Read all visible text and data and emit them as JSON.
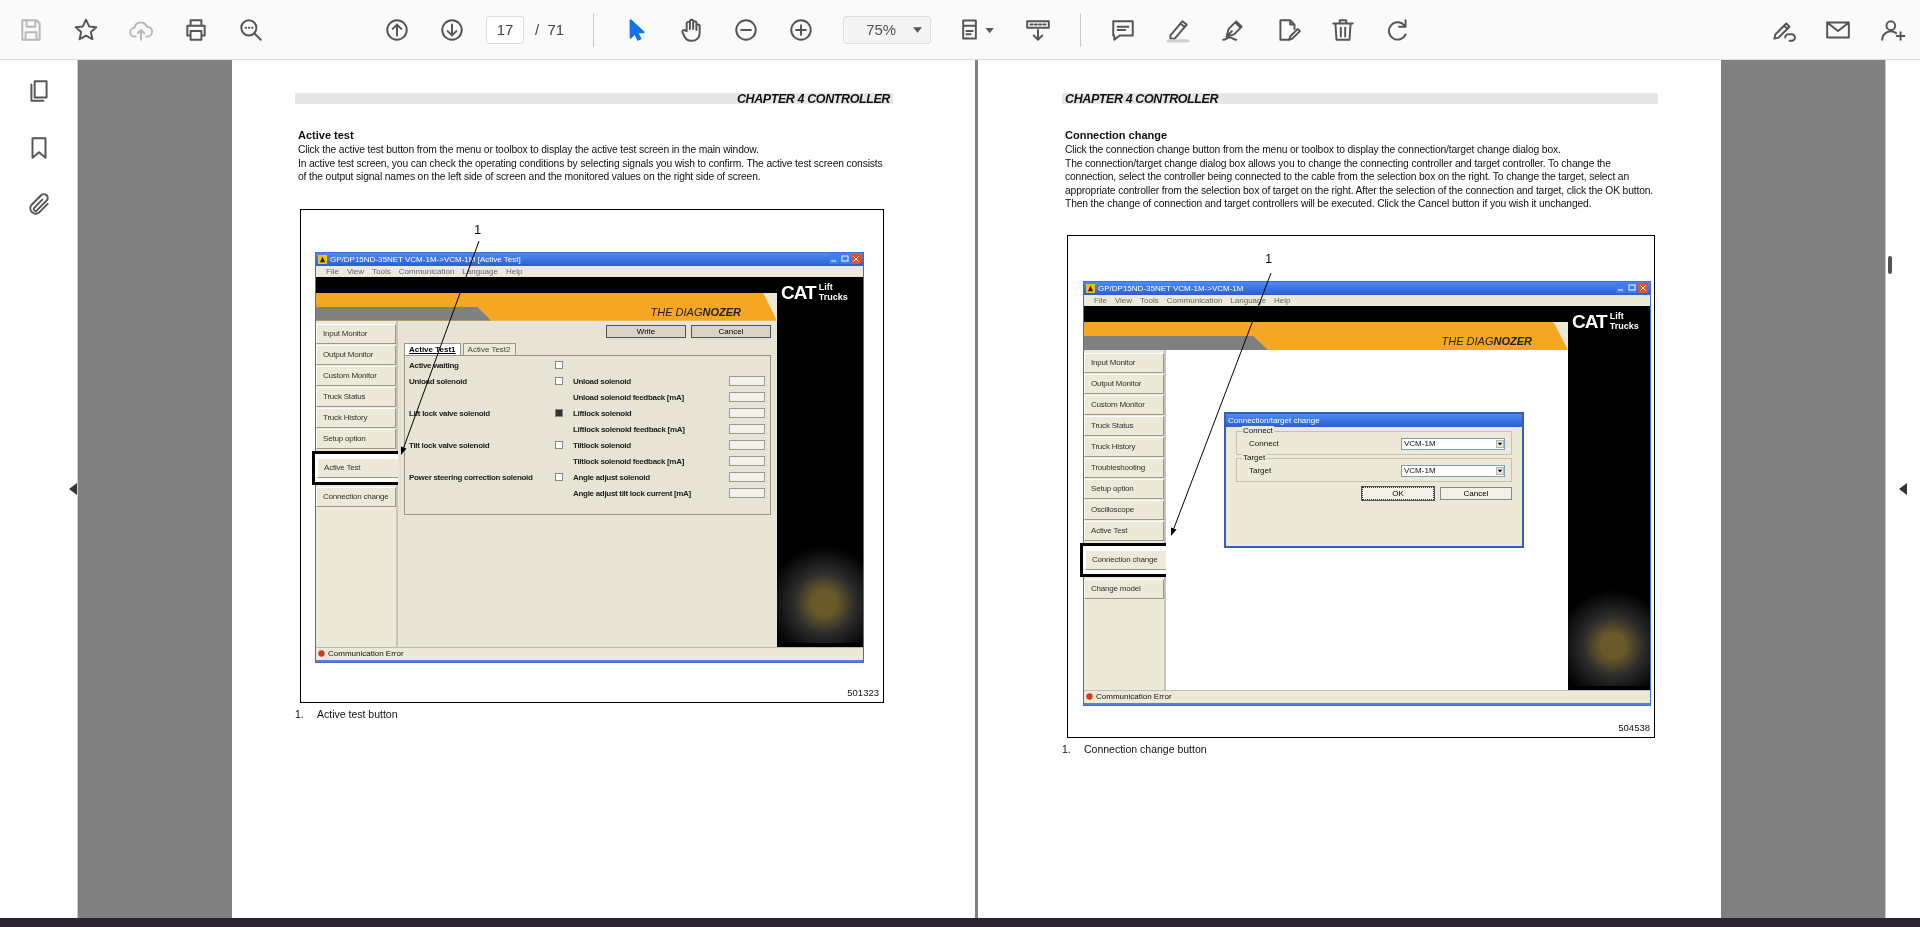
{
  "toolbar": {
    "page_current": "17",
    "page_separator": "/",
    "page_total": "71",
    "zoom": "75%"
  },
  "pages": [
    {
      "header": "CHAPTER 4 CONTROLLER",
      "heading": "Active test",
      "paragraphs": [
        "Click the active test button from the menu or toolbox to display the active test screen in the main window.",
        "In active test screen, you can check the operating conditions by selecting signals you wish to confirm. The active test screen consists of the output signal names on the left side of screen and the monitored values on the right side of screen."
      ],
      "figure": {
        "callout": "1",
        "figure_number": "501323",
        "app": {
          "kind": "active_test",
          "title": "GP/DP15ND-35NET VCM-1M->VCM-1M [Active Test]",
          "menu": [
            "File",
            "View",
            "Tools",
            "Communication",
            "Language",
            "Help"
          ],
          "banner": {
            "product": "THE DIAG**NOZER**",
            "logo": "CAT",
            "logo_lines": [
              "Lift",
              "Trucks"
            ]
          },
          "sidebar": [
            {
              "label": "Input Monitor",
              "marked": false
            },
            {
              "label": "Output Monitor",
              "marked": false
            },
            {
              "label": "Custom Monitor",
              "marked": false
            },
            {
              "label": "Truck Status",
              "marked": false
            },
            {
              "label": "Truck History",
              "marked": false
            },
            {
              "label": "Setup option",
              "marked": false
            },
            {
              "label": "Active Test",
              "marked": true
            },
            {
              "label": "Connection change",
              "marked": false
            }
          ],
          "status": "Communication Error",
          "buttons": [
            "Write",
            "Cancel"
          ],
          "tabs": [
            {
              "label": "Active Test1",
              "selected": true
            },
            {
              "label": "Active Test2",
              "selected": false
            }
          ],
          "rows": [
            {
              "output": "Active waiting",
              "checked": false
            },
            {
              "output": "Unload solenoid",
              "checked": false,
              "monitor": "Unload solenoid"
            },
            {
              "monitor": "Unload solenoid feedback [mA]"
            },
            {
              "output": "Lift lock valve solenoid",
              "checked": true,
              "monitor": "Liftlock solenoid"
            },
            {
              "monitor": "Liftlock solenoid feedback [mA]"
            },
            {
              "output": "Tilt lock valve solenoid",
              "checked": false,
              "monitor": "Tiltlock solenoid"
            },
            {
              "monitor": "Tiltlock solenoid feedback [mA]"
            },
            {
              "output": "Power steering correction solenoid",
              "checked": false,
              "monitor": "Angle adjust solenoid"
            },
            {
              "monitor": "Angle adjust tilt lock current [mA]"
            }
          ]
        }
      },
      "caption": {
        "number": "1.",
        "text": "Active test button"
      }
    },
    {
      "header": "CHAPTER 4 CONTROLLER",
      "heading": "Connection change",
      "paragraphs": [
        "Click the connection change button from the menu or toolbox to display the connection/target change dialog box.",
        "The connection/target change dialog box allows you to change the connecting controller and target controller. To change the connection, select the controller being connected to the cable from the selection box on the right. To change the target, select an appropriate controller from the selection box of target on the right. After the selection of the connection and target, click the OK button. Then the change of connection and target controllers will be executed. Click the Cancel button if you wish it unchanged."
      ],
      "figure": {
        "callout": "1",
        "figure_number": "504538",
        "app": {
          "kind": "connection_change",
          "title": "GP/DP15ND-35NET VCM-1M->VCM-1M",
          "menu": [
            "File",
            "View",
            "Tools",
            "Communication",
            "Language",
            "Help"
          ],
          "banner": {
            "product": "THE DIAG**NOZER**",
            "logo": "CAT",
            "logo_lines": [
              "Lift",
              "Trucks"
            ]
          },
          "sidebar": [
            {
              "label": "Input Monitor",
              "marked": false
            },
            {
              "label": "Output Monitor",
              "marked": false
            },
            {
              "label": "Custom Monitor",
              "marked": false
            },
            {
              "label": "Truck Status",
              "marked": false
            },
            {
              "label": "Truck History",
              "marked": false
            },
            {
              "label": "Troubleshooting",
              "marked": false
            },
            {
              "label": "Setup option",
              "marked": false
            },
            {
              "label": "Oscilloscope",
              "marked": false
            },
            {
              "label": "Active Test",
              "marked": false
            },
            {
              "label": "Connection change",
              "marked": true
            },
            {
              "label": "Change model",
              "marked": false
            }
          ],
          "status": "Communication Error",
          "dialog": {
            "title": "Connection/target change",
            "groups": [
              {
                "legend": "Connect",
                "label": "Connect",
                "value": "VCM-1M"
              },
              {
                "legend": "Target",
                "label": "Target",
                "value": "VCM-1M"
              }
            ],
            "buttons": [
              {
                "label": "OK",
                "default": true
              },
              {
                "label": "Cancel",
                "default": false
              }
            ]
          }
        }
      },
      "caption": {
        "number": "1.",
        "text": "Connection change button"
      }
    }
  ]
}
